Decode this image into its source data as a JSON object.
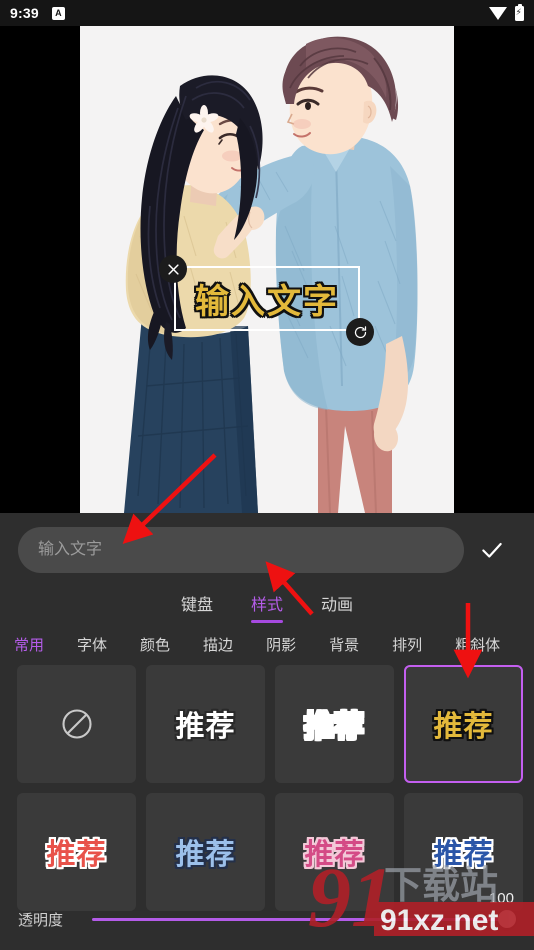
{
  "status_bar": {
    "time": "9:39",
    "badge_label": "A",
    "wifi_icon": "wifi-icon",
    "battery_icon": "battery-charging-icon"
  },
  "canvas": {
    "overlay_text": "输入文字",
    "overlay_text_color": "#e3b93b",
    "overlay_outline_color": "#111111",
    "close_icon": "close-icon",
    "rotate_icon": "rotate-icon",
    "image_description": "illustration-couple"
  },
  "panel": {
    "input": {
      "value": "",
      "placeholder": "输入文字"
    },
    "confirm_icon": "check-icon",
    "tabs": [
      {
        "label": "键盘",
        "active": false
      },
      {
        "label": "样式",
        "active": true
      },
      {
        "label": "动画",
        "active": false
      }
    ],
    "subtabs": [
      {
        "label": "常用",
        "active": true
      },
      {
        "label": "字体",
        "active": false
      },
      {
        "label": "颜色",
        "active": false
      },
      {
        "label": "描边",
        "active": false
      },
      {
        "label": "阴影",
        "active": false
      },
      {
        "label": "背景",
        "active": false
      },
      {
        "label": "排列",
        "active": false
      },
      {
        "label": "粗斜体",
        "active": false
      }
    ],
    "styles": [
      {
        "label": "",
        "icon": "ban-icon",
        "selected": false,
        "fill": "",
        "stroke": ""
      },
      {
        "label": "推荐",
        "icon": "",
        "selected": false,
        "fill": "#ffffff",
        "stroke": "#2a2a2a"
      },
      {
        "label": "推荐",
        "icon": "",
        "selected": false,
        "fill": "#ffffff",
        "stroke": "#ffffff"
      },
      {
        "label": "推荐",
        "icon": "",
        "selected": true,
        "fill": "#e3b93b",
        "stroke": "#111111"
      },
      {
        "label": "推荐",
        "icon": "",
        "selected": false,
        "fill": "#e8524a",
        "stroke": "#ffffff"
      },
      {
        "label": "推荐",
        "icon": "",
        "selected": false,
        "fill": "#9cc0ea",
        "stroke": "#24304a"
      },
      {
        "label": "推荐",
        "icon": "",
        "selected": false,
        "fill": "#d44b86",
        "stroke": "#f3c9d8"
      },
      {
        "label": "推荐",
        "icon": "",
        "selected": false,
        "fill": "#2b56a8",
        "stroke": "#ffffff"
      }
    ],
    "opacity": {
      "label": "透明度",
      "value": "100",
      "accent_color": "#b45ce8"
    }
  },
  "watermark": {
    "logo_text": "91",
    "site_text": "91xz.net",
    "sub_text": "下载站"
  },
  "annotations": {
    "color": "#ee1111",
    "count": 3
  }
}
